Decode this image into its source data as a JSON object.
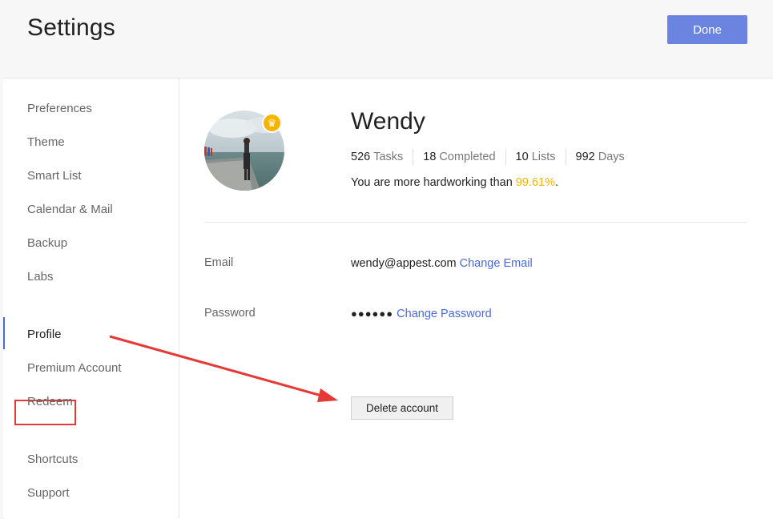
{
  "header": {
    "title": "Settings",
    "done_label": "Done"
  },
  "sidebar": {
    "groups": [
      [
        "Preferences",
        "Theme",
        "Smart List",
        "Calendar & Mail",
        "Backup",
        "Labs"
      ],
      [
        "Profile",
        "Premium Account",
        "Redeem"
      ],
      [
        "Shortcuts",
        "Support"
      ]
    ],
    "active": "Profile"
  },
  "profile": {
    "name": "Wendy",
    "stats": [
      {
        "num": "526",
        "label": "Tasks"
      },
      {
        "num": "18",
        "label": "Completed"
      },
      {
        "num": "10",
        "label": "Lists"
      },
      {
        "num": "992",
        "label": "Days"
      }
    ],
    "hardwork_prefix": "You are more hardworking than ",
    "hardwork_pct": "99.61%",
    "hardwork_suffix": "."
  },
  "account": {
    "email_label": "Email",
    "email_value": "wendy@appest.com",
    "email_link": "Change Email",
    "password_label": "Password",
    "password_mask": "●●●●●●",
    "password_link": "Change Password",
    "delete_label": "Delete account"
  },
  "colors": {
    "accent": "#6b84e0",
    "link": "#4a6bd6",
    "highlight": "#f5b400",
    "annotation": "#e53935"
  },
  "icons": {
    "avatar": "user-avatar-photo",
    "badge": "crown-icon",
    "annotation": "red-arrow"
  }
}
